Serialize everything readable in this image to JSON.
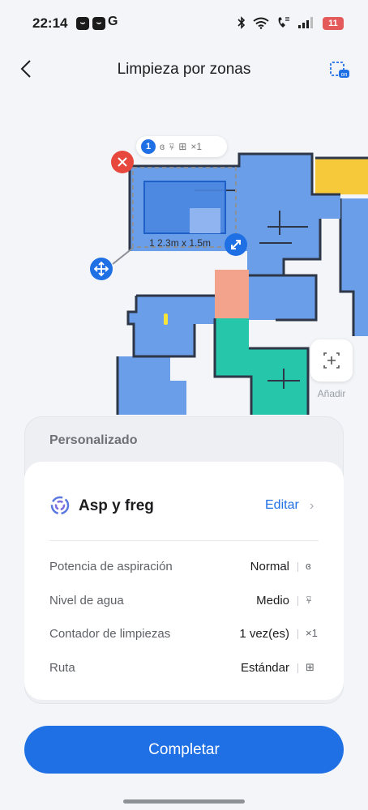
{
  "status_bar": {
    "time": "22:14",
    "notification_letter": "G",
    "battery": "11"
  },
  "header": {
    "title": "Limpieza por zonas",
    "back_icon": "chevron-left-icon",
    "map_on_icon": "map-on-icon"
  },
  "map": {
    "zone_number": "1",
    "zone_count": "×1",
    "zone_dimensions": "1 2.3m x 1.5m",
    "add_label": "Añadir",
    "room_colors": {
      "blue": "#6b9ee8",
      "orange": "#f3a28c",
      "teal": "#26c6aa",
      "yellow": "#f5c93a",
      "selection": "#2d6fe0"
    }
  },
  "panel": {
    "section_title": "Personalizado",
    "mode_name": "Asp y freg",
    "edit_label": "Editar",
    "edit_chevron": "›",
    "rows": [
      {
        "label": "Potencia de aspiración",
        "value": "Normal",
        "icon": "suction-icon",
        "glyph": "ɞ"
      },
      {
        "label": "Nivel de agua",
        "value": "Medio",
        "icon": "water-drop-icon",
        "glyph": "⍫"
      },
      {
        "label": "Contador de limpiezas",
        "value": "1 vez(es)",
        "icon": "times-icon",
        "glyph": "×1"
      },
      {
        "label": "Ruta",
        "value": "Estándar",
        "icon": "route-icon",
        "glyph": "⊞"
      }
    ]
  },
  "actions": {
    "complete_label": "Completar"
  },
  "colors": {
    "accent": "#1f6fe5",
    "danger": "#e8473e"
  }
}
